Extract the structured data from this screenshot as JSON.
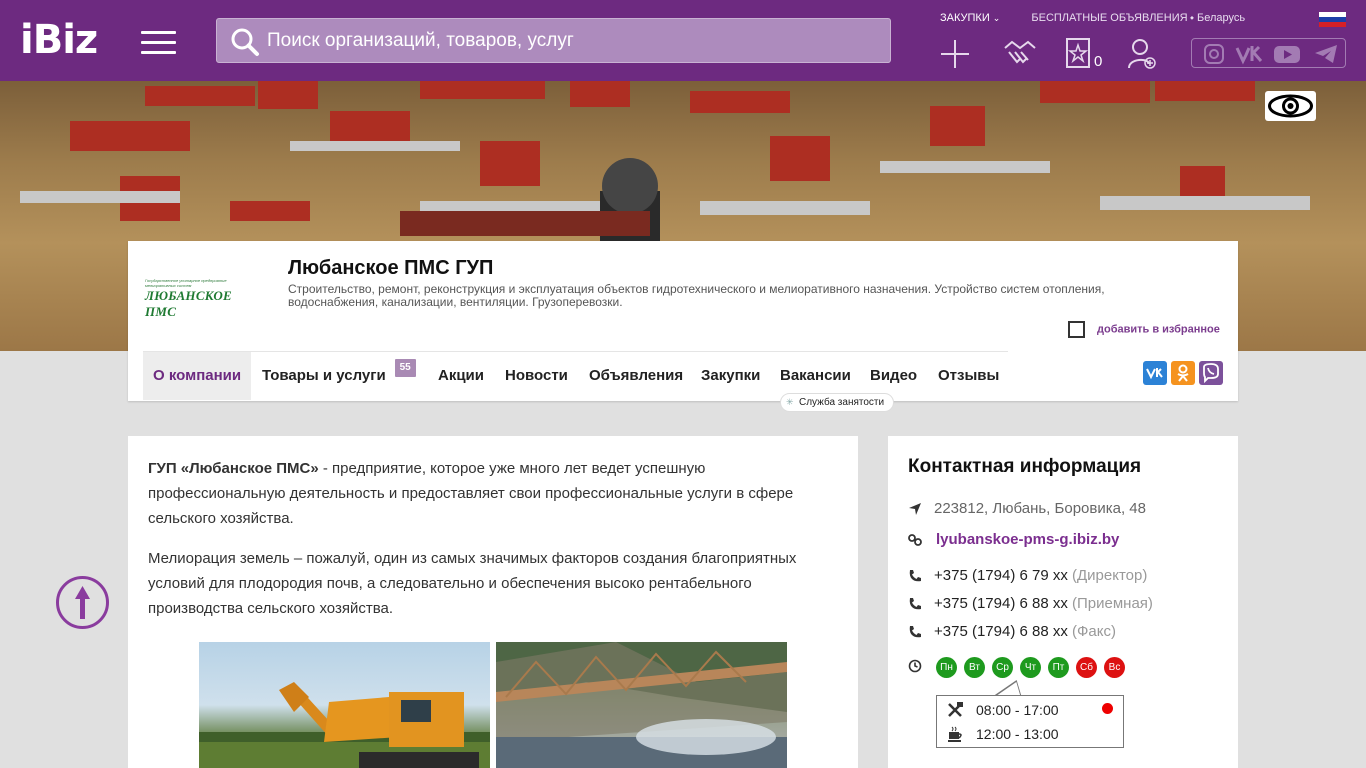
{
  "header": {
    "logo": "iBiz",
    "search_placeholder": "Поиск организаций, товаров, услуг",
    "links": {
      "purchases": "ЗАКУПКИ",
      "free_ads": "БЕСПЛАТНЫЕ ОБЪЯВЛЕНИЯ",
      "region": "Беларусь"
    },
    "favorites_count": "0"
  },
  "company": {
    "logo_small": "Государственное унитарное предприятие мелиоративных систем",
    "logo_name": "ЛЮБАНСКОЕ ПМС",
    "name": "Любанское ПМС ГУП",
    "description": "Строительство, ремонт, реконструкция и эксплуатация объектов гидротехнического и мелиоративного назначения. Устройство систем отопления, водоснабжения, канализации, вентиляции. Грузоперевозки.",
    "add_favorite": "добавить в избранное"
  },
  "tabs": [
    {
      "label": "О компании"
    },
    {
      "label": "Товары и услуги",
      "badge": "55"
    },
    {
      "label": "Акции"
    },
    {
      "label": "Новости"
    },
    {
      "label": "Объявления"
    },
    {
      "label": "Закупки"
    },
    {
      "label": "Вакансии"
    },
    {
      "label": "Видео"
    },
    {
      "label": "Отзывы"
    }
  ],
  "vacancy_hint": "Служба занятости",
  "share": {
    "vk": "VK",
    "ok": "OK",
    "viber": "Viber"
  },
  "about": {
    "p1_bold": "ГУП «Любанское ПМС»",
    "p1_rest": " - предприятие, которое уже много лет ведет успешную профессиональную деятельность и предоставляет свои профессиональные услуги в сфере сельского хозяйства.",
    "p2": "Мелиорация земель – пожалуй, один из самых значимых факторов создания благоприятных условий для плодородия почв, а следовательно и обеспечения высоко рентабельного производства сельского хозяйства."
  },
  "contacts": {
    "title": "Контактная информация",
    "address": "223812, Любань, Боровика, 48",
    "site": "lyubanskoe-pms-g.ibiz.by",
    "phones": [
      {
        "number": "+375 (1794) 6 79 xx",
        "note": "(Директор)"
      },
      {
        "number": "+375 (1794) 6 88 xx",
        "note": "(Приемная)"
      },
      {
        "number": "+375 (1794) 6 88 xx",
        "note": "(Факс)"
      }
    ],
    "days": [
      {
        "label": "Пн",
        "color": "#1e9a1e"
      },
      {
        "label": "Вт",
        "color": "#1e9a1e"
      },
      {
        "label": "Ср",
        "color": "#1e9a1e"
      },
      {
        "label": "Чт",
        "color": "#1e9a1e"
      },
      {
        "label": "Пт",
        "color": "#1e9a1e"
      },
      {
        "label": "Сб",
        "color": "#dd1111"
      },
      {
        "label": "Вс",
        "color": "#dd1111"
      }
    ],
    "work_hours": "08:00 - 17:00",
    "lunch_hours": "12:00 - 13:00"
  },
  "colors": {
    "brand": "#6d2a80",
    "link": "#7b2e8f",
    "open": "#1e9a1e",
    "closed": "#dd1111"
  }
}
